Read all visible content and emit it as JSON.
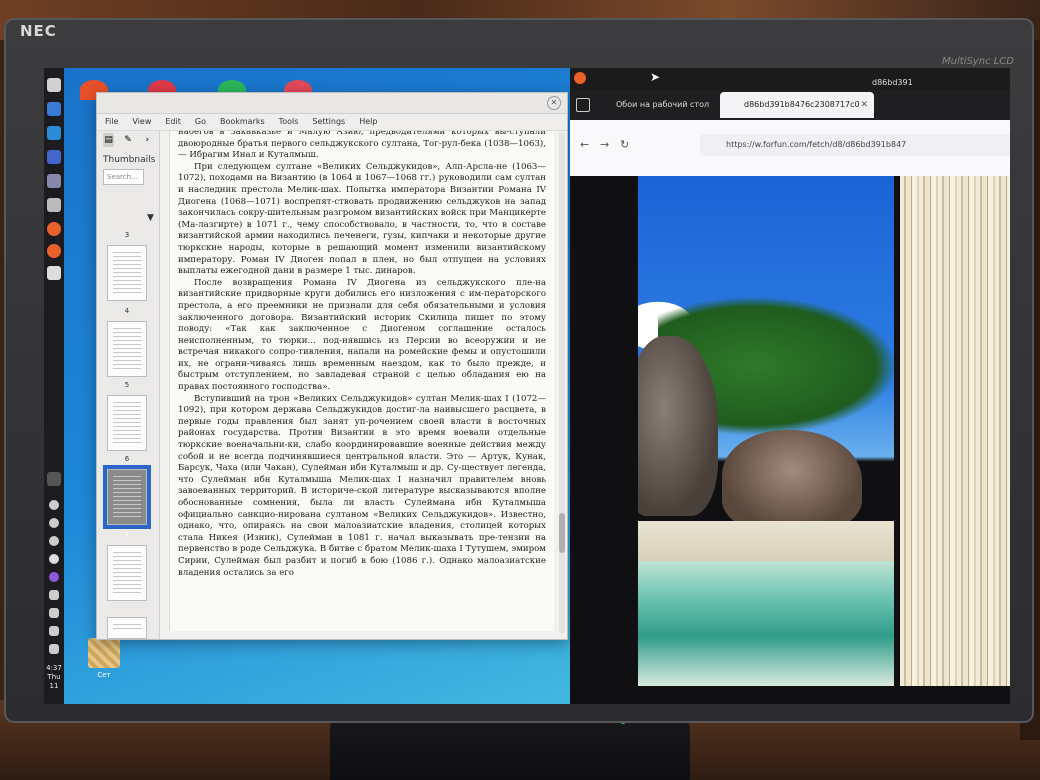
{
  "monitor": {
    "brand": "NEC",
    "model": "MultiSync LCD"
  },
  "desktop": {
    "dock_time": [
      "4:37",
      "Thu",
      "11"
    ],
    "icon_label": "Сет"
  },
  "reader": {
    "menu": [
      "File",
      "View",
      "Edit",
      "Go",
      "Bookmarks",
      "Tools",
      "Settings",
      "Help"
    ],
    "sidebar": {
      "title": "Thumbnails",
      "search_placeholder": "Search...",
      "page_numbers": [
        "3",
        "4",
        "5",
        "6",
        "7"
      ],
      "selected_page": "7"
    },
    "paragraphs": [
      "набегов в Закавказье и Малую Азию, предводителями которых вы-ступали двоюродные братья первого сельджукского султана, Тог-рул-бека (1038—1063), — Ибрагим Инал и Куталмыш.",
      "При следующем султане «Великих Сельджукидов», Алп-Арсла-не (1063—1072), походами на Византию (в 1064 и 1067—1068 гг.) руководили сам султан и наследник престола Мелик-шах. Попытка императора Византии Романа IV Диогена (1068—1071) воспрепят-ствовать продвижению сельджуков на запад закончилась сокру-шительным разгромом византийских войск при Манцикерте (Ма-лазгирте) в 1071 г., чему способствовало, в частности, то, что в составе византийской армии находились печенеги, гузы, кипчаки и некоторые другие тюркские народы, которые в решающий момент изменили византийскому императору. Роман IV Диоген попал в плен, но был отпущен на условиях выплаты ежегодной дани в размере 1 тыс. динаров.",
      "После возвращения Романа IV Диогена из сельджукского пле-на византийские придворные круги добились его низложения с им-ператорского престола, а его преемники не признали для себя обязательными и условия заключенного договора. Византийский историк Скилица пишет по этому поводу: «Так как заключенное с Диогеном соглашение осталось неисполненным, то тюрки... под-нявшись из Персии во всеоружии и не встречая никакого сопро-тивления, напали на ромейские фемы и опустошили их, не ограни-чиваясь лишь временным наездом, как то было прежде, и быстрым отступлением, но завладевая страной с целью обладания ею на правах постоянного господства».",
      "Вступивший на трон «Великих Сельджукидов» султан Мелик-шах I (1072—1092), при котором держава Сельджукидов достиг-ла наивысшего расцвета, в первые годы правления был занят уп-рочением своей власти в восточных районах государства. Против Византии в это время воевали отдельные тюркские военачальни-ки, слабо координировавшие военные действия между собой и не всегда подчинявшиеся центральной власти. Это — Артук, Кунак, Барсук, Чаха (или Чакан), Сулейман ибн Куталмыш и др. Су-ществует легенда, что Сулейман ибн Куталмыша Мелик-шах I назначил правителем вновь завоеванных территорий. В историче-ской литературе высказываются вполне обоснованные сомнения, была ли власть Сулеймана ибн Куталмыша официально санкцио-нирована султаном «Великих Сельджукидов». Известно, однако, что, опираясь на свои малоазиатские владения, столицей которых стала Никея (Изник), Сулейман в 1081 г. начал выказывать пре-тензии на первенство в роде Сельджука. В битве с братом Мелик-шаха I Тутушем, эмиром Сирии, Сулейман был разбит и погиб в бою (1086 г.). Однако малоазиатские владения остались за его"
    ]
  },
  "browser": {
    "tabs": [
      {
        "title": "Обои на рабочий стол",
        "active": false
      },
      {
        "title": "d86bd391b8476c2308717c0",
        "active": true
      },
      {
        "title": "d86bd391",
        "active": false
      }
    ],
    "url": "https://w.forfun.com/fetch/d8/d86bd391b847"
  }
}
